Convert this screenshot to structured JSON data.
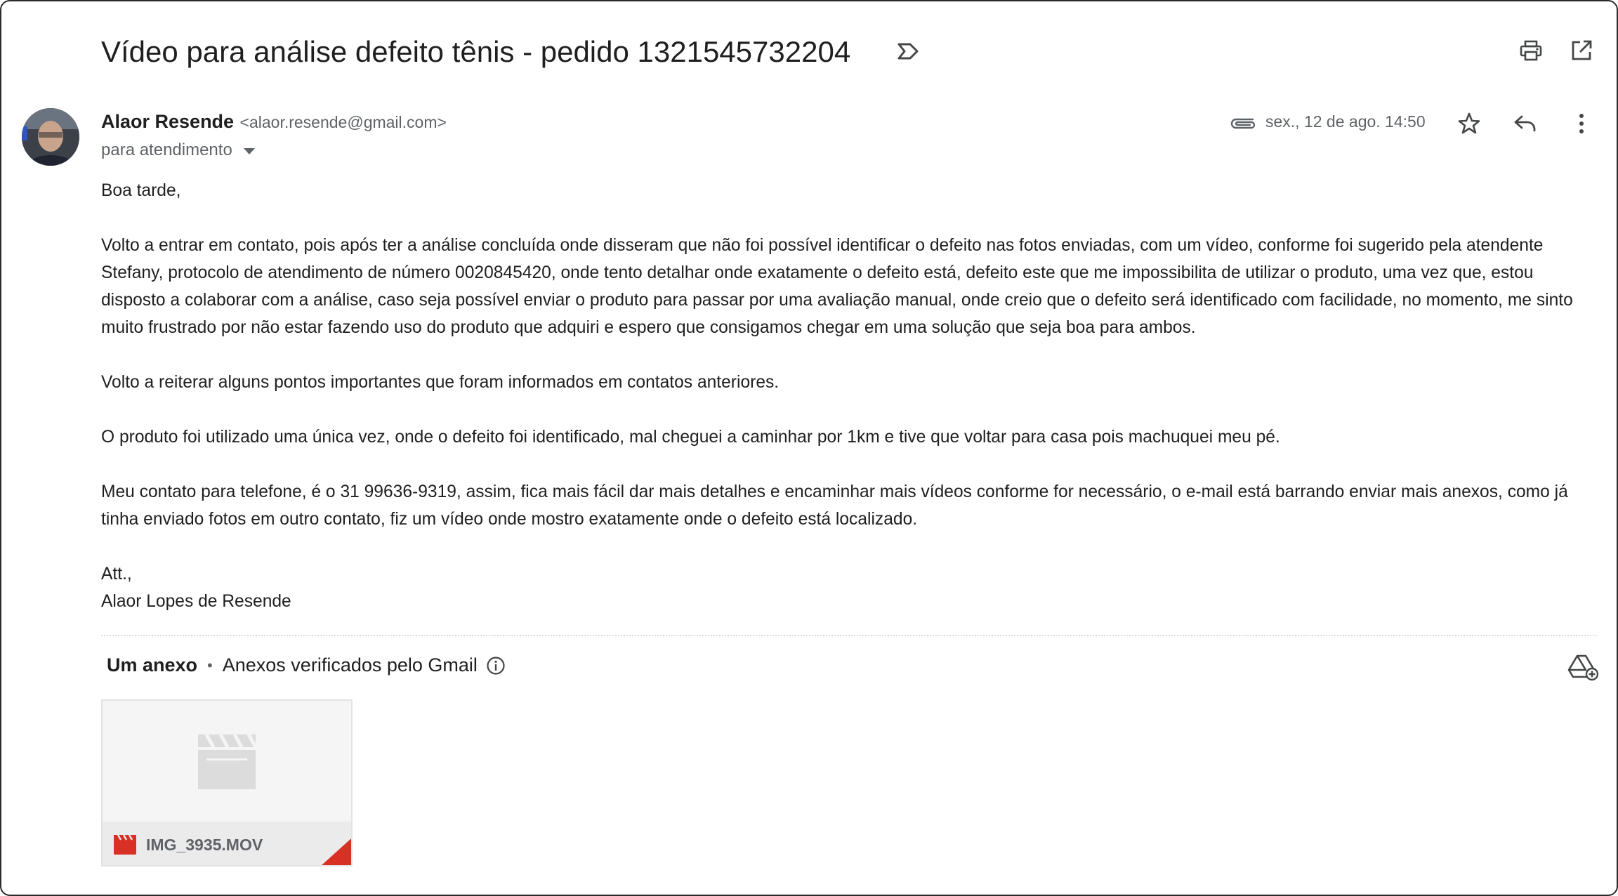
{
  "email": {
    "subject": "Vídeo para análise defeito tênis - pedido 1321545732204",
    "sender": {
      "name": "Alaor Resende",
      "email": "<alaor.resende@gmail.com>"
    },
    "recipients": "para atendimento",
    "date": "sex., 12 de ago. 14:50",
    "body": [
      "Boa tarde,",
      "Volto a entrar em contato, pois após ter a análise concluída onde disseram que não foi possível identificar o defeito nas fotos enviadas, com um vídeo, conforme foi sugerido pela atendente Stefany, protocolo de atendimento de número 0020845420, onde tento detalhar onde exatamente o defeito está, defeito este que me impossibilita de utilizar o produto, uma vez que, estou disposto a colaborar com a análise, caso seja possível enviar o produto para passar por uma avaliação manual, onde creio que o defeito será identificado com facilidade, no momento, me sinto muito frustrado por não estar fazendo uso do produto que adquiri e espero que consigamos chegar em uma solução que seja boa para ambos.",
      "Volto a reiterar alguns pontos importantes que foram informados em contatos anteriores.",
      "O produto foi utilizado uma única vez, onde o defeito foi identificado, mal cheguei a caminhar por 1km e tive que voltar para casa pois machuquei meu pé.",
      "Meu contato para telefone, é o 31 99636-9319, assim, fica mais fácil dar mais detalhes e encaminhar mais vídeos conforme for necessário, o e-mail está barrando enviar mais anexos, como já tinha enviado fotos em outro contato, fiz um vídeo onde mostro exatamente onde o defeito está localizado."
    ],
    "signoff": "Att.,",
    "signature": "Alaor Lopes de Resende"
  },
  "attachments": {
    "count_label": "Um anexo",
    "separator": "•",
    "verified_label": "Anexos verificados pelo Gmail",
    "files": [
      {
        "name": "IMG_3935.MOV",
        "icon": "video-file-icon"
      }
    ]
  },
  "colors": {
    "text": "#1f1f1f",
    "secondary_text": "#5f6368",
    "video_red": "#d93025"
  }
}
